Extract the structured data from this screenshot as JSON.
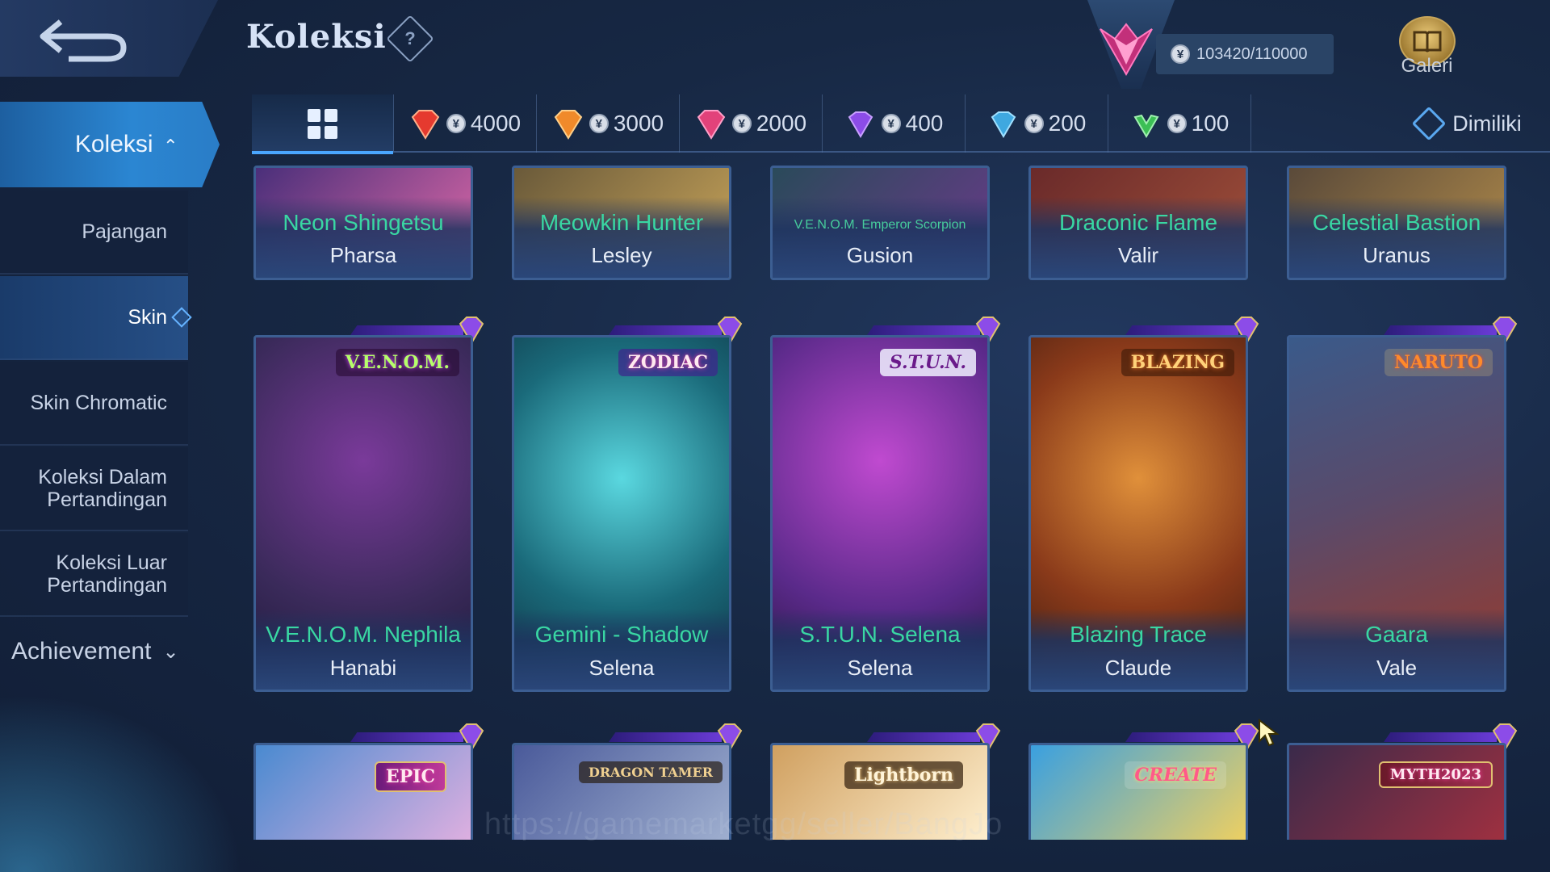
{
  "header": {
    "title": "Koleksi",
    "help_symbol": "?",
    "points": "103420/110000",
    "coin_symbol": "¥",
    "galeri_label": "Galeri"
  },
  "sidebar": {
    "main_label": "Koleksi",
    "main_chevron": "⌄",
    "items": [
      {
        "label": "Pajangan"
      },
      {
        "label": "Skin"
      },
      {
        "label": "Skin Chromatic"
      },
      {
        "label": "Koleksi Dalam Pertandingan"
      },
      {
        "label": "Koleksi Luar Pertandingan"
      }
    ],
    "achievement_label": "Achievement",
    "achievement_chevron": "⌄"
  },
  "tabs": {
    "items": [
      {
        "value": "4000",
        "color": "#e53a2f"
      },
      {
        "value": "3000",
        "color": "#f08a2a"
      },
      {
        "value": "2000",
        "color": "#e2427a"
      },
      {
        "value": "400",
        "color": "#8c4ce8"
      },
      {
        "value": "200",
        "color": "#3fa8e0"
      },
      {
        "value": "100",
        "color": "#3cbf55"
      }
    ],
    "owned_label": "Dimiliki"
  },
  "cards_row1": [
    {
      "skin": "Neon Shingetsu",
      "hero": "Pharsa",
      "bg1": "#4a2f7a",
      "bg2": "#e06aa8"
    },
    {
      "skin": "Meowkin Hunter",
      "hero": "Lesley",
      "bg1": "#6a5a3a",
      "bg2": "#c9a55a"
    },
    {
      "skin": "V.E.N.O.M. Emperor Scorpion",
      "hero": "Gusion",
      "bg1": "#2a4a5a",
      "bg2": "#6a3a8a"
    },
    {
      "skin": "Draconic Flame",
      "hero": "Valir",
      "bg1": "#6a2a2a",
      "bg2": "#a0503a"
    },
    {
      "skin": "Celestial Bastion",
      "hero": "Uranus",
      "bg1": "#5a4a3a",
      "bg2": "#b08a4a"
    }
  ],
  "cards_row2": [
    {
      "skin": "V.E.N.O.M. Nephila",
      "hero": "Hanabi",
      "series": "V.E.N.O.M.",
      "bg1": "#3a2a5a",
      "bg2": "#7a3a9a",
      "accent": "#d04aff"
    },
    {
      "skin": "Gemini - Shadow",
      "hero": "Selena",
      "series": "ZODIAC",
      "bg1": "#1a6a7a",
      "bg2": "#5ad8e0",
      "accent": "#7a4aff"
    },
    {
      "skin": "S.T.U.N. Selena",
      "hero": "Selena",
      "series": "S.T.U.N.",
      "bg1": "#5a2a8a",
      "bg2": "#c04ad0",
      "accent": "#ff4a9a"
    },
    {
      "skin": "Blazing Trace",
      "hero": "Claude",
      "series": "BLAZING",
      "bg1": "#8a3a1a",
      "bg2": "#e0903a",
      "accent": "#ff7a2a"
    },
    {
      "skin": "Gaara",
      "hero": "Vale",
      "series": "NARUTO",
      "bg1": "#3a5a8a",
      "bg2": "#9a3a2a",
      "accent": "#e04a3a"
    }
  ],
  "cards_row3": [
    {
      "series": "EPIC",
      "bg1": "#4a8ad0",
      "bg2": "#e0b0e0"
    },
    {
      "series": "DRAGON TAMER",
      "bg1": "#4a5a9a",
      "bg2": "#a0b0d0"
    },
    {
      "series": "Lightborn",
      "bg1": "#d0a060",
      "bg2": "#fff0d0"
    },
    {
      "series": "CREATE",
      "bg1": "#3aa0e0",
      "bg2": "#f0d060"
    },
    {
      "series": "MYTH2023",
      "bg1": "#3a2a4a",
      "bg2": "#a03040"
    }
  ],
  "watermark": "https://gamemarketgg/seller/BangJo"
}
